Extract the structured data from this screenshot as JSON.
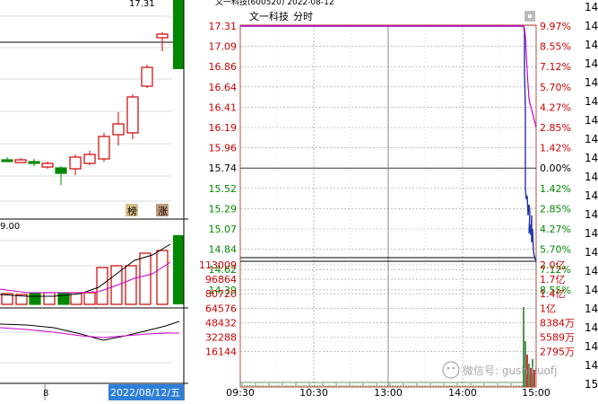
{
  "stock_name": "文一科技",
  "mode_label": "分时",
  "top_banner": "文一科技(600520) 2022-08-12",
  "kline": {
    "top_price": "17.31",
    "vol_label": "9.00",
    "badges": [
      "榜",
      "涨"
    ],
    "date_num": "8",
    "date": "2022/08/12/五"
  },
  "price_ticks": [
    "17.31",
    "17.09",
    "16.86",
    "16.64",
    "16.41",
    "16.19",
    "15.96",
    "15.74",
    "15.52",
    "15.29",
    "15.07",
    "14.84",
    "14.62",
    "14.39"
  ],
  "pct_ticks": [
    "9.97%",
    "8.55%",
    "7.12%",
    "5.70%",
    "4.27%",
    "2.85%",
    "1.42%",
    "0.00%",
    "1.42%",
    "2.85%",
    "4.27%",
    "5.70%",
    "7.12%",
    "8.55%"
  ],
  "vol_ticks_left": [
    "113009",
    "96864",
    "80720",
    "64576",
    "48432",
    "32288",
    "16144"
  ],
  "vol_ticks_right": [
    "2.0亿",
    "1.7亿",
    "1.4亿",
    "1亿",
    "8384万",
    "5589万",
    "2795万"
  ],
  "time_ticks": [
    "09:30",
    "10:30",
    "13:00",
    "14:00",
    "15:00"
  ],
  "right_column": [
    "14",
    "14",
    "14",
    "14",
    "14",
    "14",
    "14",
    "14",
    "14",
    "14",
    "14",
    "14",
    "14",
    "14",
    "14",
    "14",
    "14",
    "14",
    "14",
    "14",
    "15"
  ],
  "watermark": "微信号: gushiliuofj",
  "colors": {
    "up": "#cc0000",
    "down": "#008800",
    "price_line": "#0000ff",
    "avg_line": "#cc00cc",
    "bg": "#ffffff"
  }
}
